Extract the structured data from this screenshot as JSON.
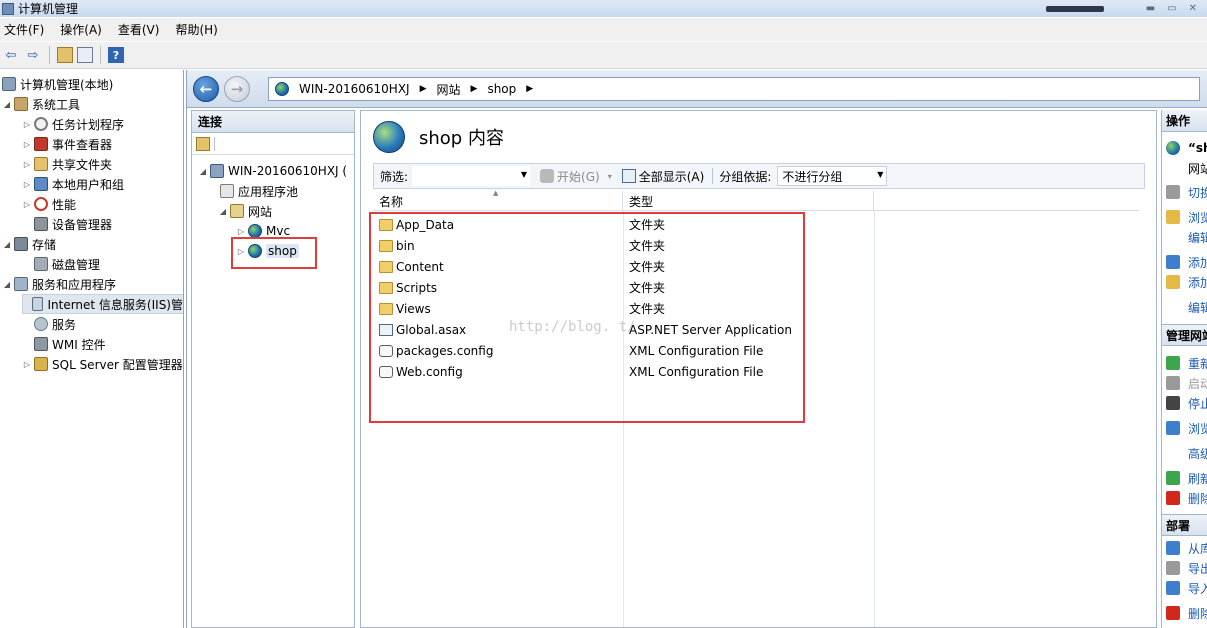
{
  "window": {
    "title": "计算机管理"
  },
  "menu": [
    "文件(F)",
    "操作(A)",
    "查看(V)",
    "帮助(H)"
  ],
  "left_tree": {
    "root": "计算机管理(本地)",
    "items": [
      "系统工具",
      "任务计划程序",
      "事件查看器",
      "共享文件夹",
      "本地用户和组",
      "性能",
      "设备管理器",
      "存储",
      "磁盘管理",
      "服务和应用程序",
      "Internet 信息服务(IIS)管",
      "服务",
      "WMI 控件",
      "SQL Server 配置管理器"
    ]
  },
  "address_bar": {
    "crumbs": [
      "WIN-20160610HXJ",
      "网站",
      "shop"
    ]
  },
  "connections": {
    "title": "连接",
    "server": "WIN-20160610HXJ (",
    "app_pools": "应用程序池",
    "sites": "网站",
    "site_mvc": "Mvc",
    "site_shop": "shop"
  },
  "content": {
    "title": "shop 内容",
    "filter_label": "筛选:",
    "start_label": "开始(G)",
    "show_all_label": "全部显示(A)",
    "group_by_label": "分组依据:",
    "group_by_value": "不进行分组",
    "col_name": "名称",
    "col_type": "类型",
    "rows": [
      {
        "name": "App_Data",
        "type": "文件夹",
        "icon": "folder-icon"
      },
      {
        "name": "bin",
        "type": "文件夹",
        "icon": "folder-icon"
      },
      {
        "name": "Content",
        "type": "文件夹",
        "icon": "folder-icon"
      },
      {
        "name": "Scripts",
        "type": "文件夹",
        "icon": "folder-icon"
      },
      {
        "name": "Views",
        "type": "文件夹",
        "icon": "folder-icon"
      },
      {
        "name": "Global.asax",
        "type": "ASP.NET Server Application",
        "icon": "asax-file-icon"
      },
      {
        "name": "packages.config",
        "type": "XML Configuration File",
        "icon": "config-file-icon"
      },
      {
        "name": "Web.config",
        "type": "XML Configuration File",
        "icon": "config-file-icon"
      }
    ],
    "watermark": "http://blog.        t/"
  },
  "actions": {
    "title": "操作",
    "site_name": "“sh",
    "site_sub": "网站",
    "items": [
      "切换",
      "浏览",
      "编辑",
      "添加",
      "添加",
      "编辑"
    ],
    "manage_section": "管理网站",
    "manage_items": [
      "重新",
      "启动",
      "停止",
      "浏览",
      "高级",
      "刷新",
      "删除"
    ],
    "deploy_section": "部署",
    "deploy_items": [
      "从库",
      "导出",
      "导入",
      "删除"
    ]
  },
  "colors": {
    "highlight": "#e03c3c",
    "accent": "#1c5bb5"
  }
}
